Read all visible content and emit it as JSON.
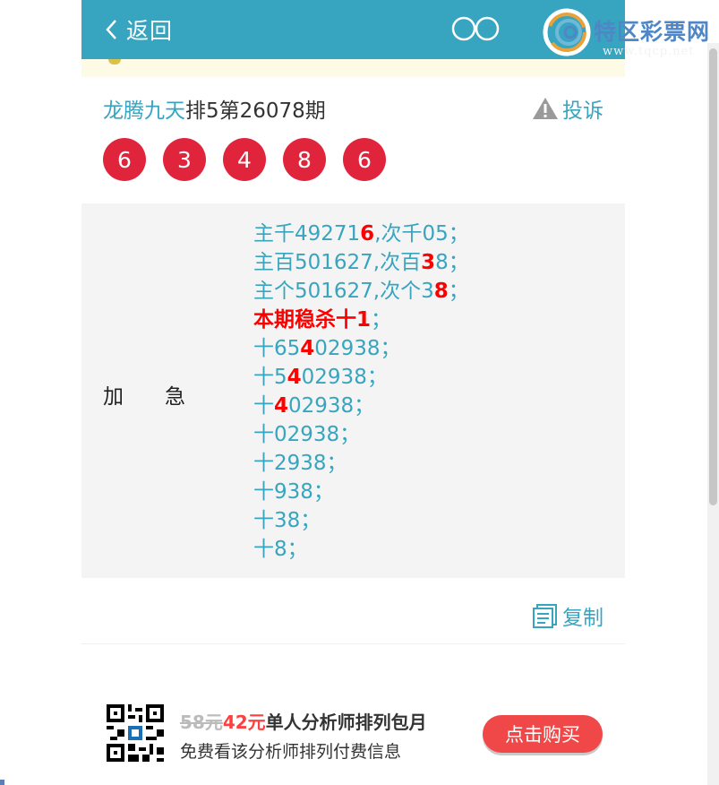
{
  "header": {
    "back_label": "返回",
    "bg": "#37a5c0"
  },
  "watermark": {
    "text": "特区彩票网",
    "url": "www.tqcp.net"
  },
  "title": {
    "author": "龙腾九天",
    "issue": "排5第26078期",
    "complain_label": "投诉"
  },
  "balls": [
    "6",
    "3",
    "4",
    "8",
    "6"
  ],
  "content": {
    "category": "加急",
    "lines": [
      {
        "pre": "主千49271",
        "hl": "6",
        "post": ",次千05；"
      },
      {
        "pre": "主百501627,次百",
        "hl": "3",
        "post": "8；"
      },
      {
        "pre": "主个501627,次个3",
        "hl": "8",
        "post": "；"
      },
      {
        "pre": "",
        "hl": "本期稳杀十1",
        "post": "；"
      },
      {
        "pre": "十65",
        "hl": "4",
        "post": "02938；"
      },
      {
        "pre": "十5",
        "hl": "4",
        "post": "02938；"
      },
      {
        "pre": "十",
        "hl": "4",
        "post": "02938；"
      },
      {
        "pre": "十02938；",
        "hl": "",
        "post": ""
      },
      {
        "pre": "十2938；",
        "hl": "",
        "post": ""
      },
      {
        "pre": "十938；",
        "hl": "",
        "post": ""
      },
      {
        "pre": "十38；",
        "hl": "",
        "post": ""
      },
      {
        "pre": "十8；",
        "hl": "",
        "post": ""
      }
    ]
  },
  "copy_label": "复制",
  "promo": {
    "old_price": "58元",
    "new_price": "42元",
    "title": "单人分析师排列包月",
    "subtitle": "免费看该分析师排列付费信息",
    "buy_label": "点击购买"
  },
  "colors": {
    "accent": "#37a5c0",
    "ball": "#e0243c",
    "highlight": "#ff0000",
    "buy": "#f04848"
  }
}
